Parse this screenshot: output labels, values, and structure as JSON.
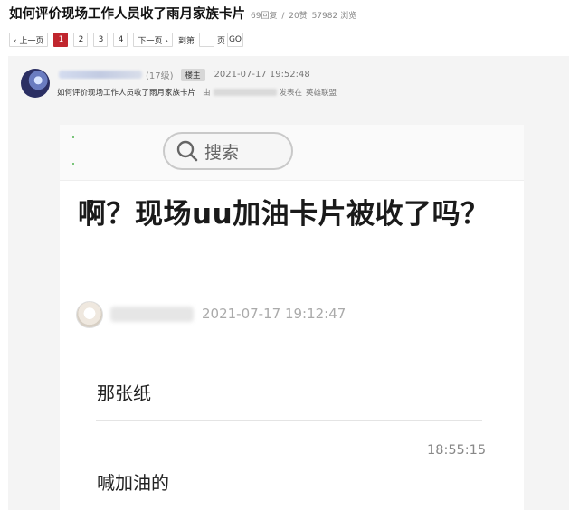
{
  "thread": {
    "title": "如何评价现场工作人员收了雨月家族卡片",
    "replies": "69回复",
    "separator": "/",
    "likes": "20赞",
    "views": "57982 浏览"
  },
  "pagination": {
    "prev_label": "‹ 上一页",
    "pages": [
      "1",
      "2",
      "3",
      "4"
    ],
    "current_page": "1",
    "next_label": "下一页 ›",
    "goto_prefix": "到第",
    "goto_value": "",
    "goto_suffix": "页",
    "go_label": "GO"
  },
  "post": {
    "level": "(17级)",
    "badge": "楼主",
    "time": "2021-07-17 19:52:48",
    "subject": "如何评价现场工作人员收了雨月家族卡片",
    "by_label": "由",
    "posted_in_label": "发表在",
    "forum": "英雄联盟"
  },
  "screenshot": {
    "search_label": "搜索",
    "article_title": "啊？现场uu加油卡片被收了吗？",
    "article_date": "2021-07-17 19:12:47",
    "message_1": "那张纸",
    "message_time": "18:55:15",
    "message_2": "喊加油的"
  },
  "icons": {
    "search": "search-icon",
    "avatar": "avatar"
  },
  "colors": {
    "accent": "#c0262e",
    "badge_bg": "#d7d7d7"
  }
}
